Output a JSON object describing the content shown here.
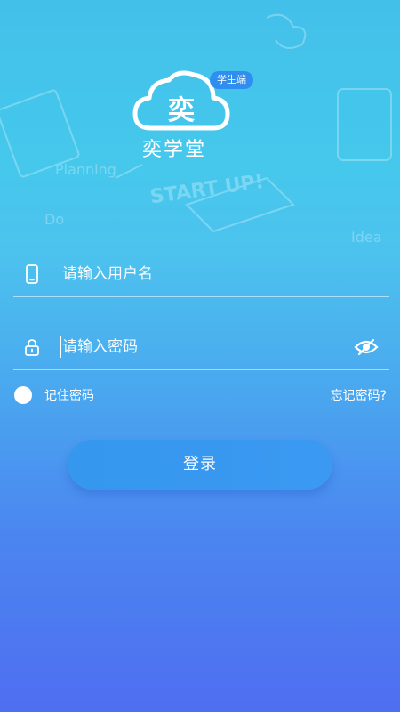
{
  "app": {
    "name": "奕学堂",
    "badge": "学生端",
    "logo_glyph": "奕"
  },
  "background_sketch": {
    "planning": "Planning",
    "start_up": "START UP!",
    "do": "Do",
    "idea": "Idea"
  },
  "login_form": {
    "username_placeholder": "请输入用户名",
    "password_placeholder": "请输入密码",
    "remember_label": "记住密码",
    "forgot_label": "忘记密码?",
    "submit_label": "登录"
  },
  "icons": {
    "username": "phone-icon",
    "password": "lock-icon",
    "toggle_password": "eye-slash-icon",
    "logo": "cloud-logo-icon"
  },
  "colors": {
    "gradient_top": "#43c0ea",
    "gradient_bottom": "#4f6ef1",
    "badge": "#2f8ef0",
    "button": "#3597ee"
  }
}
